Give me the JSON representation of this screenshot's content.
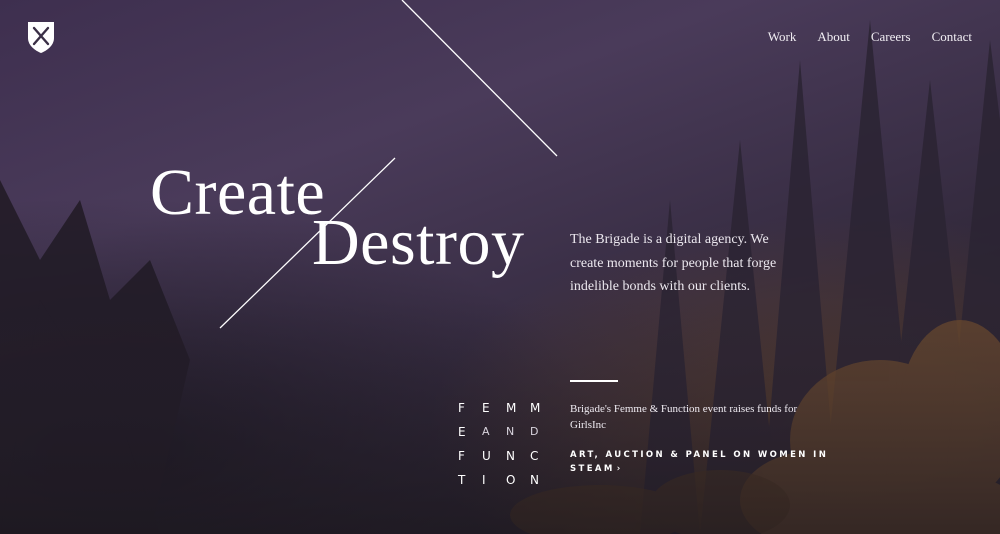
{
  "header": {
    "nav": [
      {
        "label": "Work"
      },
      {
        "label": "About"
      },
      {
        "label": "Careers"
      },
      {
        "label": "Contact"
      }
    ]
  },
  "hero": {
    "word_1": "Create",
    "word_2": "Destroy",
    "intro": "The Brigade is a digital agency. We create moments for people that forge indelible bonds with our clients."
  },
  "feature": {
    "logo_letters": [
      [
        "F",
        "E",
        "M",
        "M"
      ],
      [
        "E",
        "A",
        "N",
        "D"
      ],
      [
        "F",
        "U",
        "N",
        "C"
      ],
      [
        "T",
        "I",
        "O",
        "N"
      ]
    ],
    "headline": "Brigade's Femme & Function event raises funds for GirlsInc",
    "cta_label": "ART, AUCTION & PANEL ON WOMEN IN STEAM",
    "cta_icon": "chevron-right-icon"
  },
  "colors": {
    "background": "#3e2f4f",
    "text": "#ffffff"
  }
}
